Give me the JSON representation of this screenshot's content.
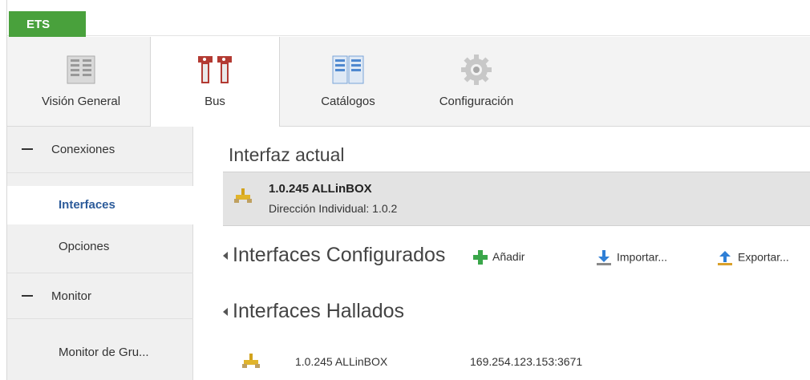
{
  "app": {
    "tab": "ETS"
  },
  "ribbon": {
    "tabs": [
      {
        "label": "Visión General",
        "icon": "overview-icon"
      },
      {
        "label": "Bus",
        "icon": "bus-icon",
        "active": true
      },
      {
        "label": "Catálogos",
        "icon": "catalog-icon"
      },
      {
        "label": "Configuración",
        "icon": "gear-icon"
      }
    ]
  },
  "sidebar": {
    "groups": [
      {
        "label": "Conexiones",
        "items": [
          "Interfaces",
          "Opciones"
        ]
      },
      {
        "label": "Monitor",
        "items": [
          "Monitor de Gru..."
        ]
      }
    ],
    "active_item": "Interfaces"
  },
  "main": {
    "current_title": "Interfaz actual",
    "current": {
      "name": "1.0.245 ALLinBOX",
      "detail": "Dirección Individual: 1.0.2"
    },
    "configured": {
      "title": "Interfaces Configurados",
      "actions": [
        {
          "label": "Añadir",
          "icon": "add-icon"
        },
        {
          "label": "Importar...",
          "icon": "import-icon"
        },
        {
          "label": "Exportar...",
          "icon": "export-icon"
        }
      ]
    },
    "found": {
      "title": "Interfaces Hallados",
      "rows": [
        {
          "name": "1.0.245 ALLinBOX",
          "address": "169.254.123.153:3671"
        }
      ]
    }
  },
  "colors": {
    "ets_green": "#49a13c",
    "active_blue": "#2c5b9a",
    "add_green": "#3aa64a",
    "arrow_blue": "#2f7fd6"
  }
}
